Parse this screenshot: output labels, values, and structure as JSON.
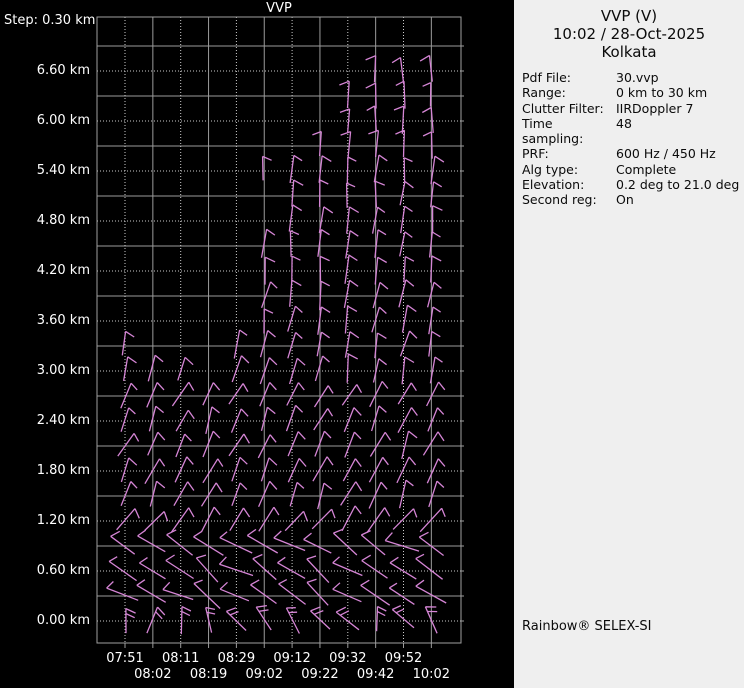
{
  "colors": {
    "background": "#000000",
    "panel_bg": "#efefef",
    "grid_solid": "#9b9b9b",
    "grid_dotted": "#cccccc",
    "frame": "#a0a0a0",
    "barb": "#d585d5",
    "plot_text": "#ffffff",
    "panel_text": "#0b0b0b"
  },
  "chart_data": {
    "type": "wind-barb-time-height-profile",
    "title": "VVP",
    "step_label": "Step: 0.30 km",
    "height_step_km": 0.3,
    "height_axis_km": [
      0.0,
      6.9
    ],
    "grid": "solid lines at odd 0.3 km steps, dotted lines at labeled 0.6 km multiples; vertical dotted at odd ticks, solid at even ticks",
    "y_labels": [
      "6.60 km",
      "6.00 km",
      "5.40 km",
      "4.80 km",
      "4.20 km",
      "3.60 km",
      "3.00 km",
      "2.40 km",
      "1.80 km",
      "1.20 km",
      "0.60 km",
      "0.00 km"
    ],
    "x_times": [
      "07:51",
      "08:02",
      "08:11",
      "08:19",
      "08:29",
      "09:02",
      "09:12",
      "09:22",
      "09:32",
      "09:42",
      "09:52",
      "10:02"
    ],
    "columns": [
      {
        "time": "07:51",
        "top_km": 3.3,
        "extra_rows_km": []
      },
      {
        "time": "08:02",
        "top_km": 3.0,
        "extra_rows_km": []
      },
      {
        "time": "08:11",
        "top_km": 3.0,
        "extra_rows_km": []
      },
      {
        "time": "08:19",
        "top_km": 2.7,
        "extra_rows_km": []
      },
      {
        "time": "08:29",
        "top_km": 3.3,
        "extra_rows_km": []
      },
      {
        "time": "09:02",
        "top_km": 4.5,
        "extra_rows_km": [
          5.4
        ]
      },
      {
        "time": "09:12",
        "top_km": 5.4,
        "extra_rows_km": []
      },
      {
        "time": "09:22",
        "top_km": 5.7,
        "extra_rows_km": []
      },
      {
        "time": "09:32",
        "top_km": 6.3,
        "extra_rows_km": []
      },
      {
        "time": "09:42",
        "top_km": 6.6,
        "extra_rows_km": []
      },
      {
        "time": "09:52",
        "top_km": 6.6,
        "extra_rows_km": []
      },
      {
        "time": "10:02",
        "top_km": 6.6,
        "extra_rows_km": []
      }
    ],
    "direction_profile": [
      {
        "max_h_km": 0.15,
        "staff_angle_deg": 105,
        "ticks": 2,
        "tick_side": "right",
        "jitter_deg": 42,
        "len_mul": 1.0
      },
      {
        "max_h_km": 1.05,
        "staff_angle_deg": 147,
        "ticks": 1,
        "tick_side": "right",
        "jitter_deg": 16,
        "len_mul": 1.25
      },
      {
        "max_h_km": 1.35,
        "staff_angle_deg": 52,
        "ticks": 1,
        "tick_side": "right",
        "jitter_deg": 14,
        "len_mul": 1.1
      },
      {
        "max_h_km": 2.85,
        "staff_angle_deg": 66,
        "ticks": 1,
        "tick_side": "right",
        "jitter_deg": 12,
        "len_mul": 1.0
      },
      {
        "max_h_km": 4.05,
        "staff_angle_deg": 80,
        "ticks": 1,
        "tick_side": "right",
        "jitter_deg": 10,
        "len_mul": 1.0
      },
      {
        "max_h_km": 5.55,
        "staff_angle_deg": 86,
        "ticks": 1,
        "tick_side": "right",
        "jitter_deg": 8,
        "len_mul": 1.0
      },
      {
        "max_h_km": 9.0,
        "staff_angle_deg": 90,
        "ticks": 1,
        "tick_side": "left",
        "jitter_deg": 7,
        "len_mul": 1.0
      }
    ]
  },
  "panel": {
    "title": "VVP (V)",
    "datetime": "10:02 / 28-Oct-2025",
    "site": "Kolkata",
    "info": [
      {
        "label": "Pdf File:",
        "value": "30.vvp"
      },
      {
        "label": "Range:",
        "value": "0 km to 30 km"
      },
      {
        "label": "Clutter Filter:",
        "value": "IIRDoppler 7"
      },
      {
        "label": "Time sampling:",
        "value": "48"
      },
      {
        "label": "PRF:",
        "value": "600 Hz / 450 Hz"
      },
      {
        "label": "Alg type:",
        "value": "Complete"
      },
      {
        "label": "Elevation:",
        "value": "0.2 deg to 21.0 deg"
      },
      {
        "label": "Second reg:",
        "value": "On"
      }
    ],
    "brand": "Rainbow® SELEX-SI"
  }
}
